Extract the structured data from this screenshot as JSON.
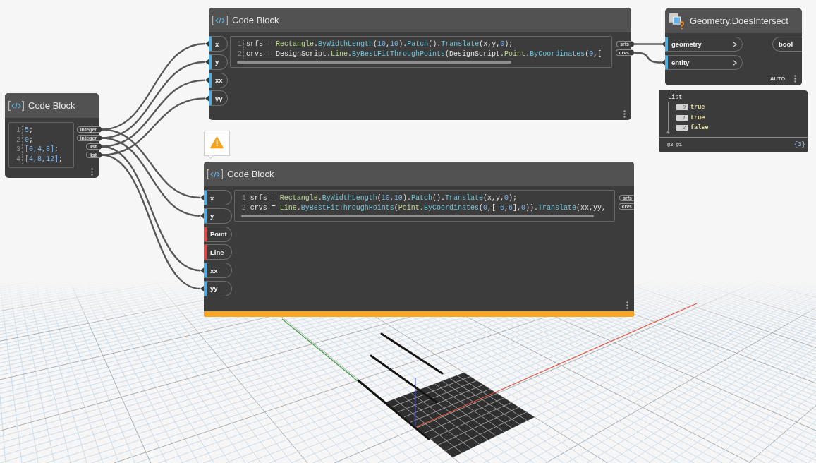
{
  "nodes": [
    {
      "kind": "code_block",
      "title": "Code Block",
      "warning": false,
      "inputs": [
        {
          "label": "x",
          "connected": true
        },
        {
          "label": "y",
          "connected": true
        },
        {
          "label": "xx",
          "connected": true
        },
        {
          "label": "yy",
          "connected": true
        }
      ],
      "code": [
        {
          "number": "1",
          "tokens": [
            {
              "kind": "plain",
              "text": "srfs = "
            },
            {
              "kind": "type",
              "text": "Rectangle"
            },
            {
              "kind": "plain",
              "text": "."
            },
            {
              "kind": "method",
              "text": "ByWidthLength"
            },
            {
              "kind": "plain",
              "text": "("
            },
            {
              "kind": "number",
              "text": "10"
            },
            {
              "kind": "plain",
              "text": ","
            },
            {
              "kind": "number",
              "text": "10"
            },
            {
              "kind": "plain",
              "text": ")."
            },
            {
              "kind": "method",
              "text": "Patch"
            },
            {
              "kind": "plain",
              "text": "()."
            },
            {
              "kind": "method",
              "text": "Translate"
            },
            {
              "kind": "plain",
              "text": "(x,y,"
            },
            {
              "kind": "number",
              "text": "0"
            },
            {
              "kind": "plain",
              "text": ");"
            }
          ]
        },
        {
          "number": "2",
          "tokens": [
            {
              "kind": "plain",
              "text": "crvs = DesignScript."
            },
            {
              "kind": "type",
              "text": "Line"
            },
            {
              "kind": "plain",
              "text": "."
            },
            {
              "kind": "method",
              "text": "ByBestFitThroughPoints"
            },
            {
              "kind": "plain",
              "text": "(DesignScript."
            },
            {
              "kind": "type",
              "text": "Point"
            },
            {
              "kind": "plain",
              "text": "."
            },
            {
              "kind": "method",
              "text": "ByCoordinates"
            },
            {
              "kind": "plain",
              "text": "("
            },
            {
              "kind": "number",
              "text": "0"
            },
            {
              "kind": "plain",
              "text": ",["
            }
          ]
        }
      ],
      "outputs": [
        {
          "label": "srfs"
        },
        {
          "label": "crvs"
        }
      ]
    },
    {
      "kind": "function",
      "title": "Geometry.DoesIntersect",
      "warning": false,
      "inputs": [
        {
          "label": "geometry",
          "connected": true
        },
        {
          "label": "entity",
          "connected": true
        }
      ],
      "outputs": [
        {
          "label": "bool"
        }
      ],
      "lacing": "AUTO",
      "preview": {
        "title": "List",
        "items": [
          {
            "index": "0",
            "value": "true"
          },
          {
            "index": "1",
            "value": "true"
          },
          {
            "index": "2",
            "value": "false"
          }
        ],
        "levels": "@2 @1",
        "count": "{3}"
      }
    },
    {
      "kind": "code_block",
      "title": "Code Block",
      "warning": false,
      "code": [
        {
          "number": "1",
          "tokens": [
            {
              "kind": "number",
              "text": "5"
            },
            {
              "kind": "plain",
              "text": ";"
            }
          ]
        },
        {
          "number": "2",
          "tokens": [
            {
              "kind": "number",
              "text": "0"
            },
            {
              "kind": "plain",
              "text": ";"
            }
          ]
        },
        {
          "number": "3",
          "tokens": [
            {
              "kind": "number",
              "text": "[0,4,8]"
            },
            {
              "kind": "plain",
              "text": ";"
            }
          ]
        },
        {
          "number": "4",
          "tokens": [
            {
              "kind": "number",
              "text": "[4,8,12]"
            },
            {
              "kind": "plain",
              "text": ";"
            }
          ]
        }
      ],
      "outputs": [
        {
          "label": "integer"
        },
        {
          "label": "integer"
        },
        {
          "label": "list"
        },
        {
          "label": "list"
        }
      ]
    },
    {
      "kind": "code_block",
      "title": "Code Block",
      "warning": true,
      "inputs": [
        {
          "label": "x",
          "connected": true
        },
        {
          "label": "y",
          "connected": true
        },
        {
          "label": "Point",
          "connected": false
        },
        {
          "label": "Line",
          "connected": false
        },
        {
          "label": "xx",
          "connected": true
        },
        {
          "label": "yy",
          "connected": true
        }
      ],
      "code": [
        {
          "number": "1",
          "tokens": [
            {
              "kind": "plain",
              "text": "srfs = "
            },
            {
              "kind": "type",
              "text": "Rectangle"
            },
            {
              "kind": "plain",
              "text": "."
            },
            {
              "kind": "method",
              "text": "ByWidthLength"
            },
            {
              "kind": "plain",
              "text": "("
            },
            {
              "kind": "number",
              "text": "10"
            },
            {
              "kind": "plain",
              "text": ","
            },
            {
              "kind": "number",
              "text": "10"
            },
            {
              "kind": "plain",
              "text": ")."
            },
            {
              "kind": "method",
              "text": "Patch"
            },
            {
              "kind": "plain",
              "text": "()."
            },
            {
              "kind": "method",
              "text": "Translate"
            },
            {
              "kind": "plain",
              "text": "(x,y,"
            },
            {
              "kind": "number",
              "text": "0"
            },
            {
              "kind": "plain",
              "text": ");"
            }
          ]
        },
        {
          "number": "2",
          "tokens": [
            {
              "kind": "plain",
              "text": "crvs = "
            },
            {
              "kind": "type",
              "text": "Line"
            },
            {
              "kind": "plain",
              "text": "."
            },
            {
              "kind": "method",
              "text": "ByBestFitThroughPoints"
            },
            {
              "kind": "plain",
              "text": "("
            },
            {
              "kind": "type",
              "text": "Point"
            },
            {
              "kind": "plain",
              "text": "."
            },
            {
              "kind": "method",
              "text": "ByCoordinates"
            },
            {
              "kind": "plain",
              "text": "("
            },
            {
              "kind": "number",
              "text": "0"
            },
            {
              "kind": "plain",
              "text": ",[-"
            },
            {
              "kind": "number",
              "text": "6"
            },
            {
              "kind": "plain",
              "text": ","
            },
            {
              "kind": "number",
              "text": "6"
            },
            {
              "kind": "plain",
              "text": "],"
            },
            {
              "kind": "number",
              "text": "0"
            },
            {
              "kind": "plain",
              "text": "))."
            },
            {
              "kind": "method",
              "text": "Translate"
            },
            {
              "kind": "plain",
              "text": "(xx,yy,"
            }
          ]
        }
      ],
      "outputs": [
        {
          "label": "srfs"
        },
        {
          "label": "crvs"
        }
      ]
    }
  ]
}
